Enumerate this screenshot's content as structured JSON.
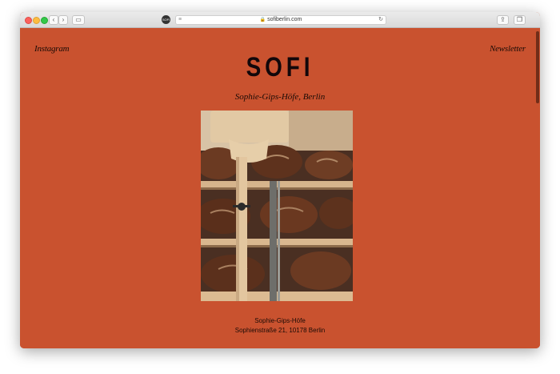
{
  "browser": {
    "url": "sofiberlin.com",
    "favicon_text": "SOFI"
  },
  "site": {
    "nav_left": "Instagram",
    "nav_right": "Newsletter",
    "logo": "SOFI",
    "subtitle": "Sophie-Gips-Höfe, Berlin",
    "address_line1": "Sophie-Gips-Höfe",
    "address_line2": "Sophienstraße 21, 10178 Berlin"
  },
  "colors": {
    "background": "#c9522f",
    "text": "#1a0b06"
  },
  "icons": [
    "back-icon",
    "forward-icon",
    "sidebar-icon",
    "lock-icon",
    "reload-icon",
    "share-icon",
    "tabs-icon"
  ]
}
